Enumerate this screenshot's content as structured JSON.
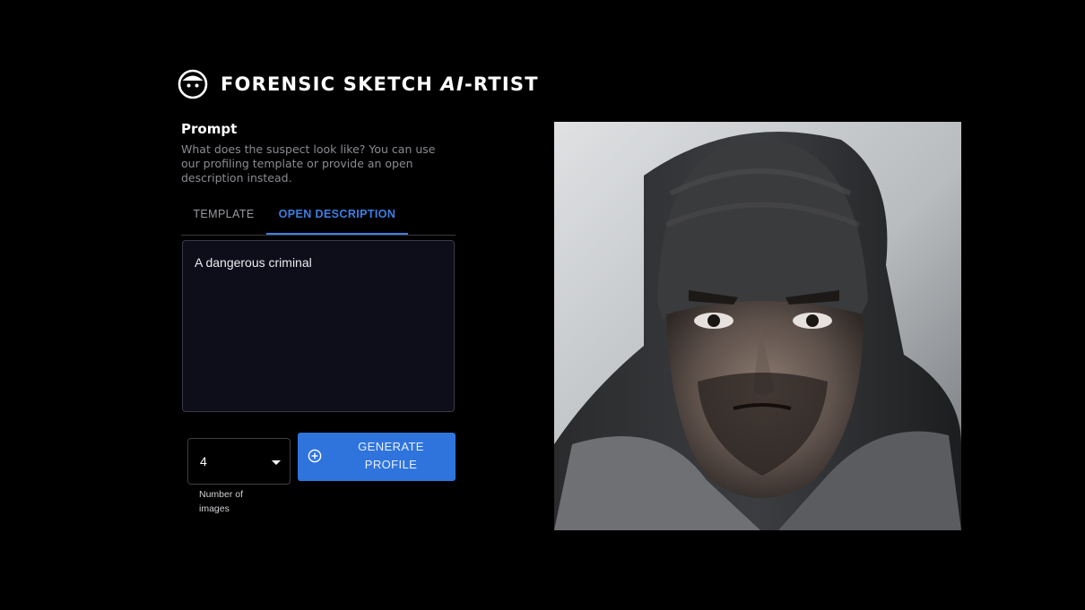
{
  "app": {
    "title_main": "FORENSIC SKETCH ",
    "title_ai": "AI",
    "title_suffix": "-RTIST",
    "logo_icon": "face-icon"
  },
  "prompt": {
    "heading": "Prompt",
    "description": "What does the suspect look like? You can use our profiling template or provide an open description instead."
  },
  "tabs": [
    {
      "label": "TEMPLATE",
      "active": false
    },
    {
      "label": "OPEN DESCRIPTION",
      "active": true
    }
  ],
  "description_input": {
    "value": "A dangerous criminal"
  },
  "image_count": {
    "value": "4",
    "helper": "Number of images"
  },
  "generate_button": {
    "label": "GENERATE PROFILE",
    "icon": "add-circle-icon"
  },
  "result": {
    "icon": "generated-portrait"
  },
  "colors": {
    "background": "#000000",
    "accent": "#2f74dc",
    "tab_active": "#3b7fe6",
    "input_background": "#0e0d1a"
  }
}
